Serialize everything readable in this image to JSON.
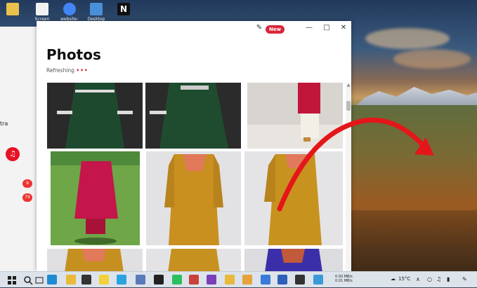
{
  "desktop": {
    "icons": [
      {
        "label": "",
        "color": "#e8c24a"
      },
      {
        "label": "Screen",
        "color": "#f2f2f2"
      },
      {
        "label": "website-vo...",
        "color": "#4285f4"
      },
      {
        "label": "Desktop",
        "color": "#4a90d9"
      },
      {
        "label": "",
        "color": "#111111"
      }
    ]
  },
  "left_panel": {
    "fragment": "tra",
    "badges": [
      "9",
      "79"
    ],
    "music_icon": "music-note-icon"
  },
  "window": {
    "title": "Photos",
    "status": "Refreshing",
    "status_dots": "•••",
    "new_badge": "New",
    "pen_icon": "✎",
    "minimize": "—",
    "maximize": "□",
    "close": "✕",
    "photos": [
      {
        "name": "photo-green-dress-1",
        "bg": "#1d3a28"
      },
      {
        "name": "photo-green-dress-2",
        "bg": "#1e3d2a"
      },
      {
        "name": "photo-pink-kurta-white-pants",
        "bg": "#d9d5d2"
      },
      {
        "name": "photo-pink-outfit-garden",
        "bg": "#6fa84a"
      },
      {
        "name": "photo-mustard-kurta-1",
        "bg": "#c9911f"
      },
      {
        "name": "photo-mustard-kurta-2",
        "bg": "#c48e1e"
      },
      {
        "name": "photo-mustard-kurta-3",
        "bg": "#c8921f"
      },
      {
        "name": "photo-mustard-kurta-4",
        "bg": "#c69020"
      },
      {
        "name": "photo-purple-kurta",
        "bg": "#3a2fa8"
      }
    ]
  },
  "taskbar": {
    "icons": [
      {
        "name": "windows-start-icon",
        "color": "#1e1e1e"
      },
      {
        "name": "search-icon",
        "color": "#1e1e1e"
      },
      {
        "name": "task-view-icon",
        "color": "#1e1e1e"
      },
      {
        "name": "edge-icon",
        "color": "#1f8bd3"
      },
      {
        "name": "file-explorer-icon",
        "color": "#e8b93a"
      },
      {
        "name": "notepad-icon",
        "color": "#333333"
      },
      {
        "name": "sticky-notes-icon",
        "color": "#f2d03a"
      },
      {
        "name": "telegram-icon",
        "color": "#2aa3df"
      },
      {
        "name": "k-app-icon",
        "color": "#5a7ab8"
      },
      {
        "name": "media-icon",
        "color": "#222222"
      },
      {
        "name": "whatsapp-icon",
        "color": "#2dbe60"
      },
      {
        "name": "photos-app-icon",
        "color": "#c8423a"
      },
      {
        "name": "onenote-icon",
        "color": "#7b3fb8"
      },
      {
        "name": "folder-icon",
        "color": "#e8b93a"
      },
      {
        "name": "chrome-icon",
        "color": "#e8a23a"
      },
      {
        "name": "network-app-icon",
        "color": "#3a7ad8"
      },
      {
        "name": "word-icon",
        "color": "#2b5fb8"
      },
      {
        "name": "settings-icon",
        "color": "#333333"
      },
      {
        "name": "mail-icon",
        "color": "#3a9ad8"
      }
    ],
    "net_up": "0.00 MB/s",
    "net_down": "0.01 MB/s",
    "weather": "15°C",
    "show_hidden_icon": "∧"
  },
  "colors": {
    "accent": "#d9263c",
    "arrow": "#e4161a"
  }
}
